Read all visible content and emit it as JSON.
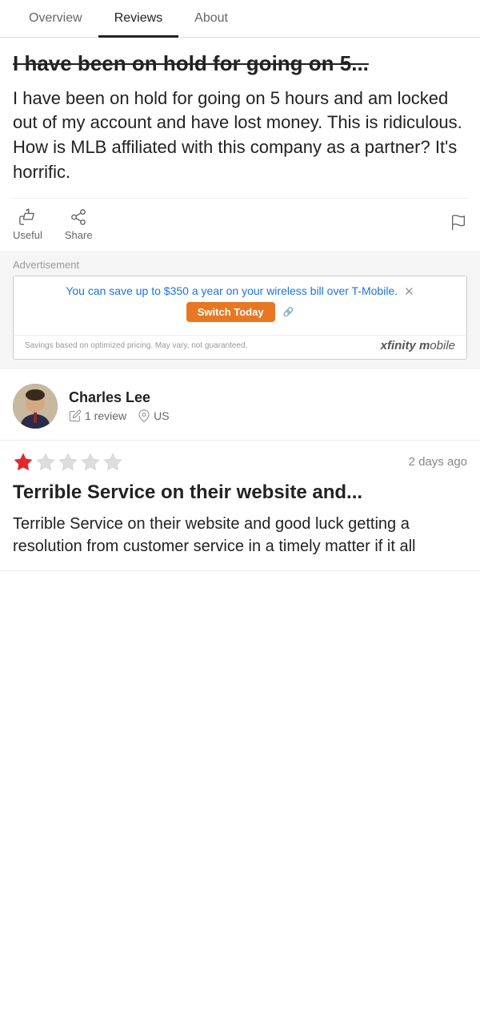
{
  "nav": {
    "tabs": [
      {
        "id": "overview",
        "label": "Overview",
        "active": false
      },
      {
        "id": "reviews",
        "label": "Reviews",
        "active": true
      },
      {
        "id": "about",
        "label": "About",
        "active": false
      }
    ]
  },
  "first_review": {
    "title_partial": "I have been on hold for going on 5...",
    "body": "I have been on hold for going on 5 hours and am locked out of my account and have lost money. This is ridiculous. How is MLB affiliated with this company as a partner? It's horrific.",
    "actions": {
      "useful_label": "Useful",
      "share_label": "Share"
    }
  },
  "advertisement": {
    "label": "Advertisement",
    "main_text": "You can save up to $350 a year on your wireless bill over T-Mobile.",
    "switch_button": "Switch Today",
    "footer_text": "Savings based on optimized pricing. May vary, not guaranteed.",
    "brand": "xfinity mobile"
  },
  "second_reviewer": {
    "name": "Charles Lee",
    "review_count": "1 review",
    "location": "US"
  },
  "second_review": {
    "star_rating": 1,
    "max_stars": 5,
    "date": "2 days ago",
    "title": "Terrible Service on their website and...",
    "body": "Terrible Service on their website and good luck getting a resolution from customer service in a timely matter if it all"
  }
}
